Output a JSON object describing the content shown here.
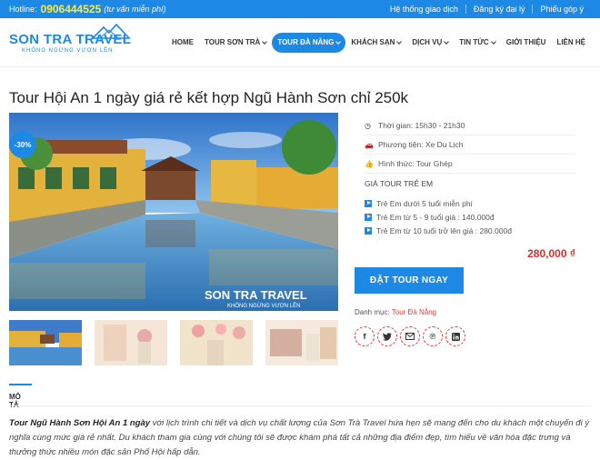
{
  "topbar": {
    "hotline_label": "Hotline:",
    "phone": "0906444525",
    "consult": "(tư vấn miễn phí)",
    "links": [
      "Hệ thống giao dịch",
      "Đăng ký đại lý",
      "Phiếu góp ý"
    ]
  },
  "logo": {
    "brand": "SON TRA TRAVEL",
    "slogan": "KHÔNG NGỪNG VƯƠN LÊN"
  },
  "nav": {
    "items": [
      {
        "label": "HOME",
        "dropdown": false
      },
      {
        "label": "TOUR SƠN TRÀ",
        "dropdown": true
      },
      {
        "label": "TOUR ĐÀ NẴNG",
        "dropdown": true,
        "active": true
      },
      {
        "label": "KHÁCH SẠN",
        "dropdown": true
      },
      {
        "label": "DỊCH VỤ",
        "dropdown": true
      },
      {
        "label": "TIN TỨC",
        "dropdown": true
      },
      {
        "label": "GIỚI THIỆU",
        "dropdown": false
      },
      {
        "label": "LIÊN HỆ",
        "dropdown": false
      }
    ]
  },
  "product": {
    "title": "Tour Hội An 1 ngày giá rẻ kết hợp Ngũ Hành Sơn chỉ 250k",
    "discount_badge": "-30%",
    "watermark_brand": "SON TRA TRAVEL",
    "watermark_slogan": "KHÔNG NGỪNG VƯƠN LÊN",
    "time": "Thời gian: 15h30 - 21h30",
    "transport": "Phương tiện: Xe Du Lịch",
    "form": "Hình thức: Tour Ghép",
    "child_price_heading": "GIÁ TOUR TRẺ EM",
    "child_prices": [
      "Trẻ Em dưới 5 tuổi miễn phí",
      "Trẻ Em từ 5 - 9 tuổi giá : 140.000đ",
      "Trẻ Em từ 10 tuổi trở lên giá : 280.000đ"
    ],
    "price": "280,000 ₫",
    "book_label": "ĐẶT TOUR NGAY",
    "category_label": "Danh mục:",
    "category_value": "Tour Đà Nẵng"
  },
  "tabs": {
    "description_label": "MÔ TẢ"
  },
  "description": {
    "bold_lead": "Tour Ngũ Hành Sơn Hội An 1 ngày",
    "text": " với lịch trình chi tiết và dịch vụ chất lượng của Sơn Trà Travel hứa hẹn sẽ mang đến cho du khách một chuyến đi ý nghĩa cùng mức giá rẻ nhất. Du khách tham gia cùng với chúng tôi sẽ được khám phá tất cả những địa điểm đẹp, tìm hiểu về văn hóa đặc trưng và thưởng thức nhiều món đặc sản Phố Hội hấp dẫn."
  },
  "colors": {
    "primary": "#1e88e5",
    "price": "#d32f2f",
    "phone": "#ffeb3b"
  }
}
